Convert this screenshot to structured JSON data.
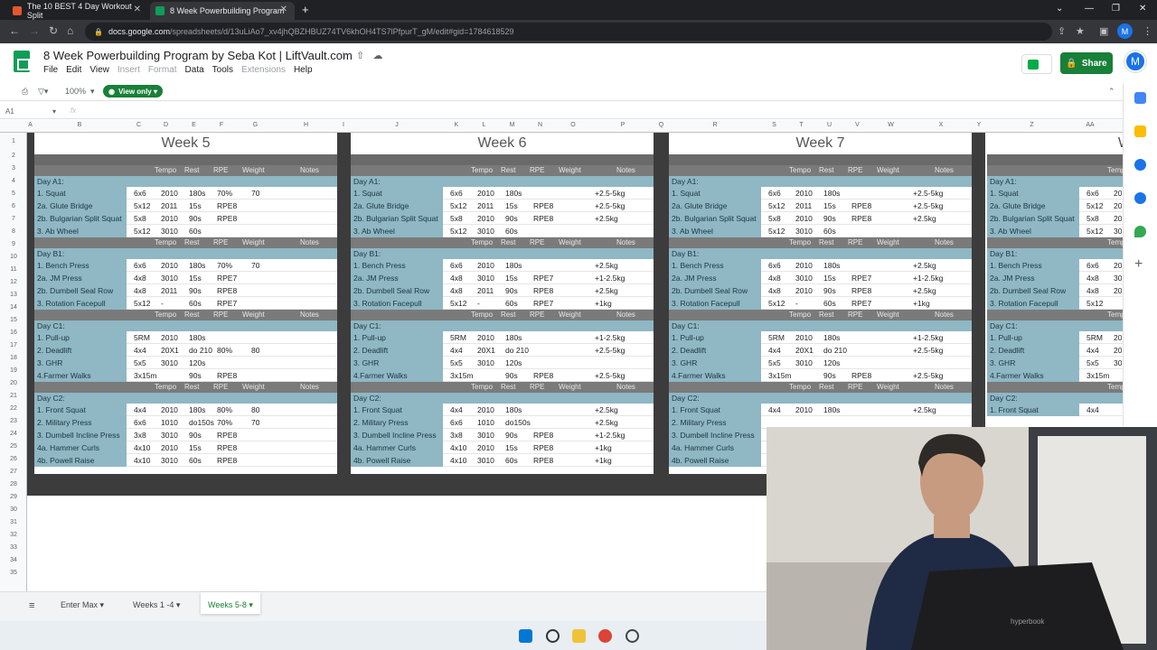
{
  "browser": {
    "tabs": [
      {
        "label": "The 10 BEST 4 Day Workout Split",
        "active": false
      },
      {
        "label": "8 Week Powerbuilding Program",
        "active": true
      }
    ],
    "url_domain": "docs.google.com",
    "url_path": "/spreadsheets/d/13uLiAo7_xv4jhQBZHBUZ74TV6khOH4TS7lPfpurT_gM/edit#gid=1784618529",
    "profile_initial": "M"
  },
  "doc": {
    "title": "8 Week Powerbuilding Program by Seba Kot | LiftVault.com",
    "menus": [
      "File",
      "Edit",
      "View",
      "Insert",
      "Format",
      "Data",
      "Tools",
      "Extensions",
      "Help"
    ],
    "share": "Share"
  },
  "toolbar": {
    "zoom": "100%",
    "view_only": "View only",
    "cell_ref": "A1",
    "fx": "fx"
  },
  "colors": {
    "accent": "#188038",
    "day_row": "#8fb7c4",
    "dark_border": "#3c3c3c",
    "header_strip": "#7a7a7a"
  },
  "columns": [
    "A",
    "B",
    "C",
    "D",
    "E",
    "F",
    "G",
    "H",
    "I",
    "J",
    "K",
    "L",
    "M",
    "N",
    "O",
    "P",
    "Q",
    "R",
    "S",
    "T",
    "U",
    "V",
    "W",
    "X",
    "Y",
    "Z",
    "AA"
  ],
  "rows": [
    "1",
    "2",
    "3",
    "4",
    "5",
    "6",
    "7",
    "8",
    "9",
    "10",
    "11",
    "12",
    "13",
    "14",
    "15",
    "16",
    "17",
    "18",
    "19",
    "20",
    "21",
    "22",
    "23",
    "24",
    "25",
    "26",
    "27",
    "28",
    "29",
    "30",
    "31",
    "32",
    "33",
    "34",
    "35"
  ],
  "headers": {
    "tempo": "Tempo",
    "rest": "Rest",
    "rpe": "RPE",
    "weight": "Weight",
    "notes": "Notes"
  },
  "weeks": [
    {
      "title": "Week 5",
      "days": [
        {
          "name": "Day A1:",
          "ex": [
            [
              "1. Squat",
              "6x6",
              "2010",
              "180s",
              "70%",
              "70",
              ""
            ],
            [
              "2a. Glute Bridge",
              "5x12",
              "2011",
              "15s",
              "RPE8",
              "",
              ""
            ],
            [
              "2b. Bulgarian Split Squat",
              "5x8",
              "2010",
              "90s",
              "RPE8",
              "",
              ""
            ],
            [
              "3. Ab Wheel",
              "5x12",
              "3010",
              "60s",
              "",
              "",
              ""
            ]
          ]
        },
        {
          "name": "Day B1:",
          "ex": [
            [
              "1. Bench Press",
              "6x6",
              "2010",
              "180s",
              "70%",
              "70",
              ""
            ],
            [
              "2a. JM Press",
              "4x8",
              "3010",
              "15s",
              "RPE7",
              "",
              ""
            ],
            [
              "2b. Dumbell Seal Row",
              "4x8",
              "2011",
              "90s",
              "RPE8",
              "",
              ""
            ],
            [
              "3. Rotation Facepull",
              "5x12",
              "-",
              "60s",
              "RPE7",
              "",
              ""
            ]
          ]
        },
        {
          "name": "Day C1:",
          "ex": [
            [
              "1. Pull-up",
              "5RM",
              "2010",
              "180s",
              "",
              "",
              ""
            ],
            [
              "2. Deadlift",
              "4x4",
              "20X1",
              "do 210",
              "80%",
              "80",
              ""
            ],
            [
              "3. GHR",
              "5x5",
              "3010",
              "120s",
              "",
              "",
              ""
            ],
            [
              "4.Farmer Walks",
              "3x15m",
              "",
              "90s",
              "RPE8",
              "",
              ""
            ]
          ]
        },
        {
          "name": "Day C2:",
          "ex": [
            [
              "1. Front Squat",
              "4x4",
              "2010",
              "180s",
              "80%",
              "80",
              ""
            ],
            [
              "2. Military Press",
              "6x6",
              "1010",
              "do150s",
              "70%",
              "70",
              ""
            ],
            [
              "3. Dumbell Incline Press",
              "3x8",
              "3010",
              "90s",
              "RPE8",
              "",
              ""
            ],
            [
              "4a. Hammer Curls",
              "4x10",
              "2010",
              "15s",
              "RPE8",
              "",
              ""
            ],
            [
              "4b. Powell Raise",
              "4x10",
              "3010",
              "60s",
              "RPE8",
              "",
              ""
            ]
          ]
        }
      ]
    },
    {
      "title": "Week 6",
      "days": [
        {
          "name": "Day A1:",
          "ex": [
            [
              "1. Squat",
              "6x6",
              "2010",
              "180s",
              "",
              "",
              "+2.5-5kg"
            ],
            [
              "2a. Glute Bridge",
              "5x12",
              "2011",
              "15s",
              "RPE8",
              "",
              "+2.5-5kg"
            ],
            [
              "2b. Bulgarian Split Squat",
              "5x8",
              "2010",
              "90s",
              "RPE8",
              "",
              "+2.5kg"
            ],
            [
              "3. Ab Wheel",
              "5x12",
              "3010",
              "60s",
              "",
              "",
              ""
            ]
          ]
        },
        {
          "name": "Day B1:",
          "ex": [
            [
              "1. Bench Press",
              "6x6",
              "2010",
              "180s",
              "",
              "",
              "+2.5kg"
            ],
            [
              "2a. JM Press",
              "4x8",
              "3010",
              "15s",
              "RPE7",
              "",
              "+1-2.5kg"
            ],
            [
              "2b. Dumbell Seal Row",
              "4x8",
              "2011",
              "90s",
              "RPE8",
              "",
              "+2.5kg"
            ],
            [
              "3. Rotation Facepull",
              "5x12",
              "-",
              "60s",
              "RPE7",
              "",
              "+1kg"
            ]
          ]
        },
        {
          "name": "Day C1:",
          "ex": [
            [
              "1. Pull-up",
              "5RM",
              "2010",
              "180s",
              "",
              "",
              "+1-2.5kg"
            ],
            [
              "2. Deadlift",
              "4x4",
              "20X1",
              "do 210",
              "",
              "",
              "+2.5-5kg"
            ],
            [
              "3. GHR",
              "5x5",
              "3010",
              "120s",
              "",
              "",
              ""
            ],
            [
              "4.Farmer Walks",
              "3x15m",
              "",
              "90s",
              "RPE8",
              "",
              "+2.5-5kg"
            ]
          ]
        },
        {
          "name": "Day C2:",
          "ex": [
            [
              "1. Front Squat",
              "4x4",
              "2010",
              "180s",
              "",
              "",
              "+2.5kg"
            ],
            [
              "2. Military Press",
              "6x6",
              "1010",
              "do150s",
              "",
              "",
              "+2.5kg"
            ],
            [
              "3. Dumbell Incline Press",
              "3x8",
              "3010",
              "90s",
              "RPE8",
              "",
              "+1-2.5kg"
            ],
            [
              "4a. Hammer Curls",
              "4x10",
              "2010",
              "15s",
              "RPE8",
              "",
              "+1kg"
            ],
            [
              "4b. Powell Raise",
              "4x10",
              "3010",
              "60s",
              "RPE8",
              "",
              "+1kg"
            ]
          ]
        }
      ]
    },
    {
      "title": "Week 7",
      "days": [
        {
          "name": "Day A1:",
          "ex": [
            [
              "1. Squat",
              "6x6",
              "2010",
              "180s",
              "",
              "",
              "+2.5-5kg"
            ],
            [
              "2a. Glute Bridge",
              "5x12",
              "2011",
              "15s",
              "RPE8",
              "",
              "+2.5-5kg"
            ],
            [
              "2b. Bulgarian Split Squat",
              "5x8",
              "2010",
              "90s",
              "RPE8",
              "",
              "+2.5kg"
            ],
            [
              "3. Ab Wheel",
              "5x12",
              "3010",
              "60s",
              "",
              "",
              ""
            ]
          ]
        },
        {
          "name": "Day B1:",
          "ex": [
            [
              "1. Bench Press",
              "6x6",
              "2010",
              "180s",
              "",
              "",
              "+2.5kg"
            ],
            [
              "2a. JM Press",
              "4x8",
              "3010",
              "15s",
              "RPE7",
              "",
              "+1-2.5kg"
            ],
            [
              "2b. Dumbell Seal Row",
              "4x8",
              "2010",
              "90s",
              "RPE8",
              "",
              "+2.5kg"
            ],
            [
              "3. Rotation Facepull",
              "5x12",
              "-",
              "60s",
              "RPE7",
              "",
              "+1kg"
            ]
          ]
        },
        {
          "name": "Day C1:",
          "ex": [
            [
              "1. Pull-up",
              "5RM",
              "2010",
              "180s",
              "",
              "",
              "+1-2.5kg"
            ],
            [
              "2. Deadlift",
              "4x4",
              "20X1",
              "do 210",
              "",
              "",
              "+2.5-5kg"
            ],
            [
              "3. GHR",
              "5x5",
              "3010",
              "120s",
              "",
              "",
              ""
            ],
            [
              "4.Farmer Walks",
              "3x15m",
              "",
              "90s",
              "RPE8",
              "",
              "+2.5-5kg"
            ]
          ]
        },
        {
          "name": "Day C2:",
          "ex": [
            [
              "1. Front Squat",
              "4x4",
              "2010",
              "180s",
              "",
              "",
              "+2.5kg"
            ],
            [
              "2. Military Press",
              "",
              "",
              "",
              "",
              "",
              ""
            ],
            [
              "3. Dumbell Incline Press",
              "",
              "",
              "",
              "",
              "",
              ""
            ],
            [
              "4a. Hammer Curls",
              "",
              "",
              "",
              "",
              "",
              ""
            ],
            [
              "4b. Powell Raise",
              "",
              "",
              "",
              "",
              "",
              ""
            ]
          ]
        }
      ]
    },
    {
      "title": "W",
      "days": [
        {
          "name": "Day A1:",
          "ex": [
            [
              "1. Squat",
              "6x6",
              "20",
              "",
              "",
              "",
              ""
            ],
            [
              "2a. Glute Bridge",
              "5x12",
              "20",
              "",
              "",
              "",
              ""
            ],
            [
              "2b. Bulgarian Split Squat",
              "5x8",
              "20",
              "",
              "",
              "",
              ""
            ],
            [
              "3. Ab Wheel",
              "5x12",
              "30",
              "",
              "",
              "",
              ""
            ]
          ]
        },
        {
          "name": "Day B1:",
          "ex": [
            [
              "1. Bench Press",
              "6x6",
              "20",
              "",
              "",
              "",
              ""
            ],
            [
              "2a. JM Press",
              "4x8",
              "30",
              "",
              "",
              "",
              ""
            ],
            [
              "2b. Dumbell Seal Row",
              "4x8",
              "20",
              "",
              "",
              "",
              ""
            ],
            [
              "3. Rotation Facepull",
              "5x12",
              "",
              "",
              "",
              "",
              ""
            ]
          ]
        },
        {
          "name": "Day C1:",
          "ex": [
            [
              "1. Pull-up",
              "5RM",
              "20",
              "",
              "",
              "",
              ""
            ],
            [
              "2. Deadlift",
              "4x4",
              "20",
              "",
              "",
              "",
              ""
            ],
            [
              "3. GHR",
              "5x5",
              "30",
              "",
              "",
              "",
              ""
            ],
            [
              "4.Farmer Walks",
              "3x15m",
              "",
              "",
              "",
              "",
              ""
            ]
          ]
        },
        {
          "name": "Day C2:",
          "ex": [
            [
              "1. Front Squat",
              "4x4",
              "",
              "",
              "",
              "",
              ""
            ]
          ]
        }
      ]
    }
  ],
  "sheet_tabs": [
    {
      "label": "Enter Max",
      "active": false
    },
    {
      "label": "Weeks 1 -4",
      "active": false
    },
    {
      "label": "Weeks 5-8",
      "active": true
    }
  ]
}
